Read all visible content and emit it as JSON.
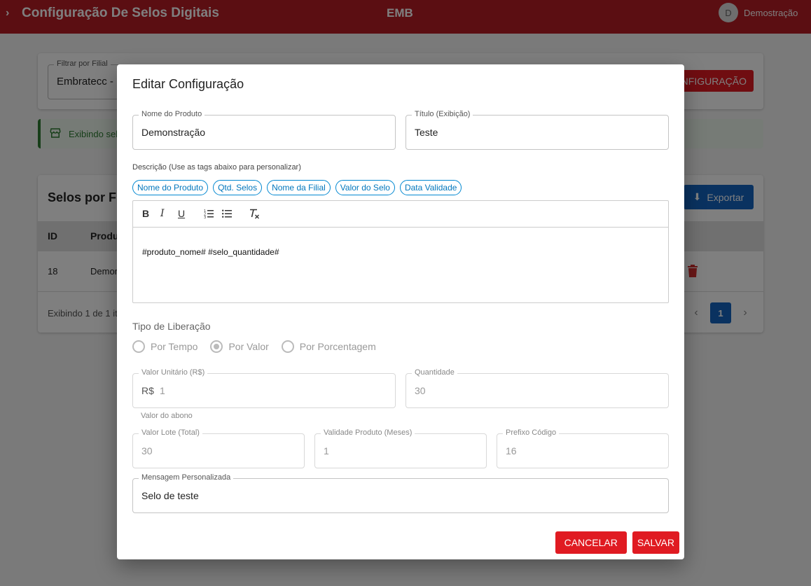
{
  "header": {
    "title": "Configuração De Selos Digitais",
    "center": "EMB",
    "avatar": "D",
    "user": "Demostração"
  },
  "background": {
    "filter_label": "Filtrar por Filial",
    "filter_value": "Embratecc - N",
    "add_button": "CONFIGURAÇÃO",
    "info_text": "Exibindo sel",
    "table_title": "Selos por F",
    "export_button": "Exportar",
    "columns": [
      "ID",
      "Produ"
    ],
    "row": {
      "id": "18",
      "product": "Demor"
    },
    "footer": "Exibindo 1 de 1 it",
    "page": "1"
  },
  "modal": {
    "title": "Editar Configuração",
    "product_name": {
      "label": "Nome do Produto",
      "value": "Demonstração"
    },
    "display_title": {
      "label": "Título (Exibição)",
      "value": "Teste"
    },
    "description_label": "Descrição (Use as tags abaixo para personalizar)",
    "tags": [
      "Nome do Produto",
      "Qtd. Selos",
      "Nome da Filial",
      "Valor do Selo",
      "Data Validade"
    ],
    "editor_content": "#produto_nome# #selo_quantidade#",
    "release_type_label": "Tipo de Liberação",
    "release_options": [
      {
        "label": "Por Tempo",
        "selected": false
      },
      {
        "label": "Por Valor",
        "selected": true
      },
      {
        "label": "Por Porcentagem",
        "selected": false
      }
    ],
    "unit_value": {
      "label": "Valor Unitário (R$)",
      "prefix": "R$",
      "value": "1",
      "helper": "Valor do abono"
    },
    "quantity": {
      "label": "Quantidade",
      "value": "30"
    },
    "batch_value": {
      "label": "Valor Lote (Total)",
      "value": "30"
    },
    "validity": {
      "label": "Validade Produto (Meses)",
      "value": "1"
    },
    "code_prefix": {
      "label": "Prefixo Código",
      "value": "16"
    },
    "custom_message": {
      "label": "Mensagem Personalizada",
      "value": "Selo de teste"
    },
    "cancel": "CANCELAR",
    "save": "SALVAR"
  },
  "colors": {
    "brand": "#b71c24",
    "action": "#e01b22",
    "chip": "#0288d1"
  }
}
